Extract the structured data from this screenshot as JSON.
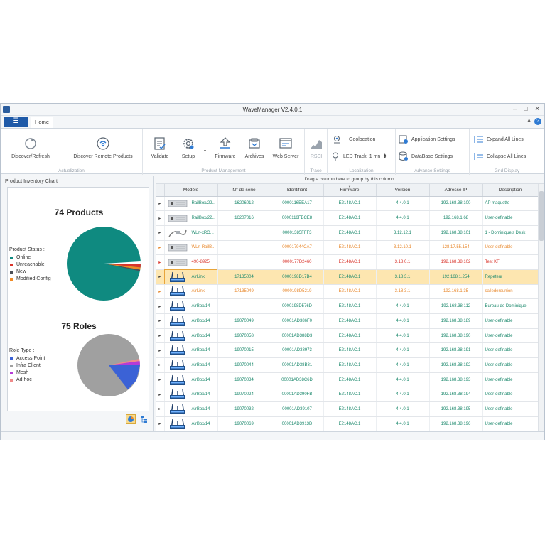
{
  "window": {
    "title": "WaveManager V2.4.0.1",
    "controls": [
      "–",
      "□",
      "✕"
    ]
  },
  "tabs": {
    "file_menu": "☰",
    "home": "Home",
    "help": "?",
    "collapse_ribbon": "▲"
  },
  "ribbon": {
    "actualization": {
      "label": "Actualization",
      "discover_refresh": "Discover/Refresh",
      "discover_remote": "Discover Remote Products"
    },
    "product_management": {
      "label": "Product Management",
      "validate": "Validate",
      "setup": "Setup",
      "firmware": "Firmware",
      "archives": "Archives",
      "web_server": "Web Server"
    },
    "trace": {
      "label": "Trace",
      "rssi": "RSSI"
    },
    "localization": {
      "label": "Localization",
      "geolocation": "Geolocation",
      "led_track": "LED Track",
      "led_track_value": "1 mn"
    },
    "advance_settings": {
      "label": "Advance Settings",
      "application_settings": "Application Settings",
      "database_settings": "DataBase Settings"
    },
    "grid_display": {
      "label": "Grid Display",
      "expand_all": "Expand All Lines",
      "collapse_all": "Collapse All Lines"
    }
  },
  "left_panel": {
    "title": "Product Inventory Chart",
    "products_chart": {
      "title": "74 Products",
      "legend_title": "Product Status :",
      "legend": [
        {
          "label": "Online",
          "color": "#0f8a80"
        },
        {
          "label": "Unreachable",
          "color": "#d9342b"
        },
        {
          "label": "New",
          "color": "#4a4f57"
        },
        {
          "label": "Modified Config",
          "color": "#f08a24"
        }
      ]
    },
    "roles_chart": {
      "title": "75 Roles",
      "legend_title": "Role Type :",
      "legend": [
        {
          "label": "Access Point",
          "color": "#3b62d6"
        },
        {
          "label": "Infra Client",
          "color": "#a0a0a0"
        },
        {
          "label": "Mesh",
          "color": "#b53bd6"
        },
        {
          "label": "Ad hoc",
          "color": "#f08a8a"
        }
      ]
    }
  },
  "grid": {
    "group_hint": "Drag a column here to group by this column.",
    "columns": [
      "Modèle",
      "N° de série",
      "Identifiant",
      "Firmware",
      "Version",
      "Adresse IP",
      "Description"
    ],
    "rows": [
      {
        "model": "RailBox/22...",
        "serial": "16206012",
        "id": "0000116EEA17",
        "firmware": "E2148AC.1",
        "version": "4.4.0.1",
        "ip": "192.168.38.100",
        "desc": "AP maquette",
        "status": "online",
        "device": "railbox"
      },
      {
        "model": "RailBox/22...",
        "serial": "16207016",
        "id": "0000116FBCE8",
        "firmware": "E2148AC.1",
        "version": "4.4.0.1",
        "ip": "192.168.1.68",
        "desc": "User-definable",
        "status": "online",
        "device": "railbox"
      },
      {
        "model": "WLn-xRO...",
        "serial": "",
        "id": "00001385FFF3",
        "firmware": "E2148AC.1",
        "version": "3.12.12.1",
        "ip": "192.168.38.101",
        "desc": "1 - Dominique's Desk",
        "status": "online",
        "device": "cable"
      },
      {
        "model": "WLn-RailB...",
        "serial": "",
        "id": "000017944CA7",
        "firmware": "E2148AC.1",
        "version": "3.12.10.1",
        "ip": "128.17.55.154",
        "desc": "User-definable",
        "status": "warn",
        "device": "railbox"
      },
      {
        "model": "490-8925",
        "serial": "",
        "id": "0000177D2460",
        "firmware": "E2148AC.1",
        "version": "3.18.0.1",
        "ip": "192.168.38.102",
        "desc": "Test KF",
        "status": "red",
        "device": "railbox"
      },
      {
        "model": "AirLink",
        "serial": "17135004",
        "id": "0000198D17B4",
        "firmware": "E2148AC.1",
        "version": "3.18.3.1",
        "ip": "192.168.1.254",
        "desc": "Repeteur",
        "status": "sel",
        "device": "airbox"
      },
      {
        "model": "AirLink",
        "serial": "17135049",
        "id": "0000198D5219",
        "firmware": "E2148AC.1",
        "version": "3.18.3.1",
        "ip": "192.168.1.35",
        "desc": "salledereunion",
        "status": "warn",
        "device": "airbox"
      },
      {
        "model": "AirBox/14",
        "serial": "",
        "id": "0000198D576D",
        "firmware": "E2148AC.1",
        "version": "4.4.0.1",
        "ip": "192.168.38.112",
        "desc": "Bureau de Dominique",
        "status": "online",
        "device": "airbox"
      },
      {
        "model": "AirBox/14",
        "serial": "19070049",
        "id": "00001AD386F0",
        "firmware": "E2148AC.1",
        "version": "4.4.0.1",
        "ip": "192.168.38.189",
        "desc": "User-definable",
        "status": "online",
        "device": "airbox"
      },
      {
        "model": "AirBox/14",
        "serial": "19070058",
        "id": "00001AD388D3",
        "firmware": "E2148AC.1",
        "version": "4.4.0.1",
        "ip": "192.168.38.190",
        "desc": "User-definable",
        "status": "online",
        "device": "airbox"
      },
      {
        "model": "AirBox/14",
        "serial": "19070015",
        "id": "00001AD38973",
        "firmware": "E2148AC.1",
        "version": "4.4.0.1",
        "ip": "192.168.38.191",
        "desc": "User-definable",
        "status": "online",
        "device": "airbox"
      },
      {
        "model": "AirBox/14",
        "serial": "19070044",
        "id": "00001AD38B81",
        "firmware": "E2148AC.1",
        "version": "4.4.0.1",
        "ip": "192.168.38.192",
        "desc": "User-definable",
        "status": "online",
        "device": "airbox"
      },
      {
        "model": "AirBox/14",
        "serial": "19070034",
        "id": "00001AD38C6D",
        "firmware": "E2148AC.1",
        "version": "4.4.0.1",
        "ip": "192.168.38.193",
        "desc": "User-definable",
        "status": "online",
        "device": "airbox"
      },
      {
        "model": "AirBox/14",
        "serial": "19070024",
        "id": "00001AD390FB",
        "firmware": "E2148AC.1",
        "version": "4.4.0.1",
        "ip": "192.168.38.194",
        "desc": "User-definable",
        "status": "online",
        "device": "airbox"
      },
      {
        "model": "AirBox/14",
        "serial": "19070032",
        "id": "00001AD39107",
        "firmware": "E2148AC.1",
        "version": "4.4.0.1",
        "ip": "192.168.38.195",
        "desc": "User-definable",
        "status": "online",
        "device": "airbox"
      },
      {
        "model": "AirBox/14",
        "serial": "19070069",
        "id": "00001AD3913D",
        "firmware": "E2148AC.1",
        "version": "4.4.0.1",
        "ip": "192.168.38.196",
        "desc": "User-definable",
        "status": "online",
        "device": "airbox"
      }
    ]
  }
}
